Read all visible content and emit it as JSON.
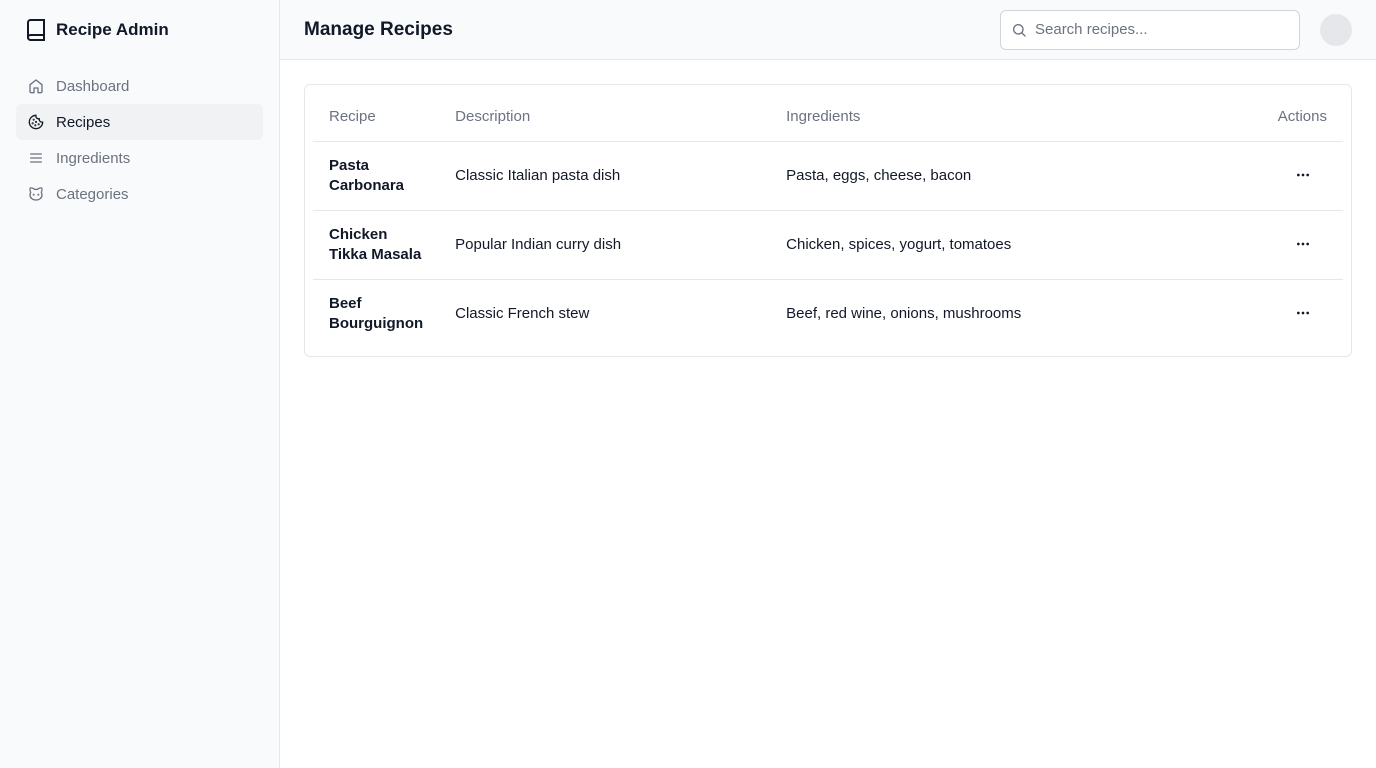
{
  "app": {
    "title": "Recipe Admin"
  },
  "sidebar": {
    "items": [
      {
        "label": "Dashboard",
        "icon": "home-icon",
        "active": false
      },
      {
        "label": "Recipes",
        "icon": "cookie-icon",
        "active": true
      },
      {
        "label": "Ingredients",
        "icon": "list-icon",
        "active": false
      },
      {
        "label": "Categories",
        "icon": "cat-icon",
        "active": false
      }
    ]
  },
  "header": {
    "title": "Manage Recipes",
    "search_placeholder": "Search recipes...",
    "search_value": ""
  },
  "table": {
    "columns": [
      "Recipe",
      "Description",
      "Ingredients",
      "Actions"
    ],
    "rows": [
      {
        "name": "Pasta Carbonara",
        "description": "Classic Italian pasta dish",
        "ingredients": "Pasta, eggs, cheese, bacon"
      },
      {
        "name": "Chicken Tikka Masala",
        "description": "Popular Indian curry dish",
        "ingredients": "Chicken, spices, yogurt, tomatoes"
      },
      {
        "name": "Beef Bourguignon",
        "description": "Classic French stew",
        "ingredients": "Beef, red wine, onions, mushrooms"
      }
    ]
  },
  "colors": {
    "sidebar_bg": "#f9fafb",
    "active_item_bg": "#f1f2f4",
    "muted_text": "#6b7280",
    "border": "#e5e7eb"
  }
}
